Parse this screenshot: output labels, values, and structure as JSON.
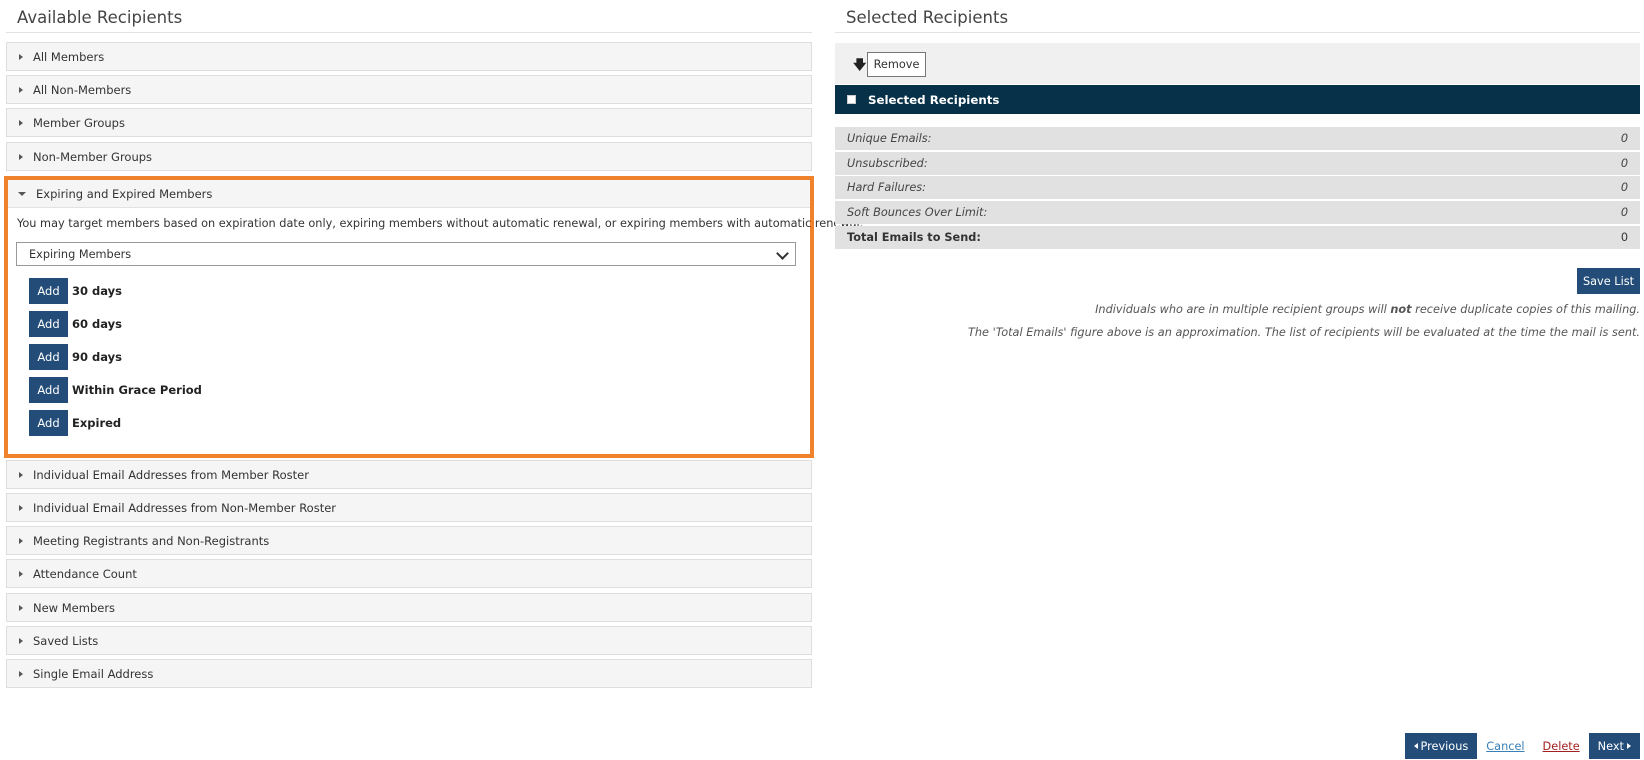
{
  "left": {
    "title": "Available Recipients",
    "accordions_top": [
      {
        "label": "All Members"
      },
      {
        "label": "All Non-Members"
      },
      {
        "label": "Member Groups"
      },
      {
        "label": "Non-Member Groups"
      }
    ],
    "open_section": {
      "label": "Expiring and Expired Members",
      "description": "You may target members based on expiration date only, expiring members without automatic renewal, or expiring members with automatic renewal.",
      "select_value": "Expiring Members",
      "add_label": "Add",
      "items": [
        {
          "label": "30 days"
        },
        {
          "label": "60 days"
        },
        {
          "label": "90 days"
        },
        {
          "label": "Within Grace Period"
        },
        {
          "label": "Expired"
        }
      ]
    },
    "accordions_bottom": [
      {
        "label": "Individual Email Addresses from Member Roster"
      },
      {
        "label": "Individual Email Addresses from Non-Member Roster"
      },
      {
        "label": "Meeting Registrants and Non-Registrants"
      },
      {
        "label": "Attendance Count"
      },
      {
        "label": "New Members"
      },
      {
        "label": "Saved Lists"
      },
      {
        "label": "Single Email Address"
      }
    ]
  },
  "right": {
    "title": "Selected Recipients",
    "remove_label": "Remove",
    "header_label": "Selected Recipients",
    "stats": [
      {
        "label": "Unique Emails:",
        "value": "0"
      },
      {
        "label": "Unsubscribed:",
        "value": "0"
      },
      {
        "label": "Hard Failures:",
        "value": "0"
      },
      {
        "label": "Soft Bounces Over Limit:",
        "value": "0"
      },
      {
        "label": "Total Emails to Send:",
        "value": "0"
      }
    ],
    "save_label": "Save List",
    "note1_pre": "Individuals who are in multiple recipient groups will ",
    "note1_bold": "not",
    "note1_post": " receive duplicate copies of this mailing.",
    "note2": "The 'Total Emails' figure above is an approximation. The list of recipients will be evaluated at the time the mail is sent."
  },
  "footer": {
    "previous": "Previous",
    "cancel": "Cancel",
    "delete": "Delete",
    "next": "Next"
  },
  "colors": {
    "accent": "#234d78",
    "header": "#063149",
    "highlight": "#f0822c"
  }
}
